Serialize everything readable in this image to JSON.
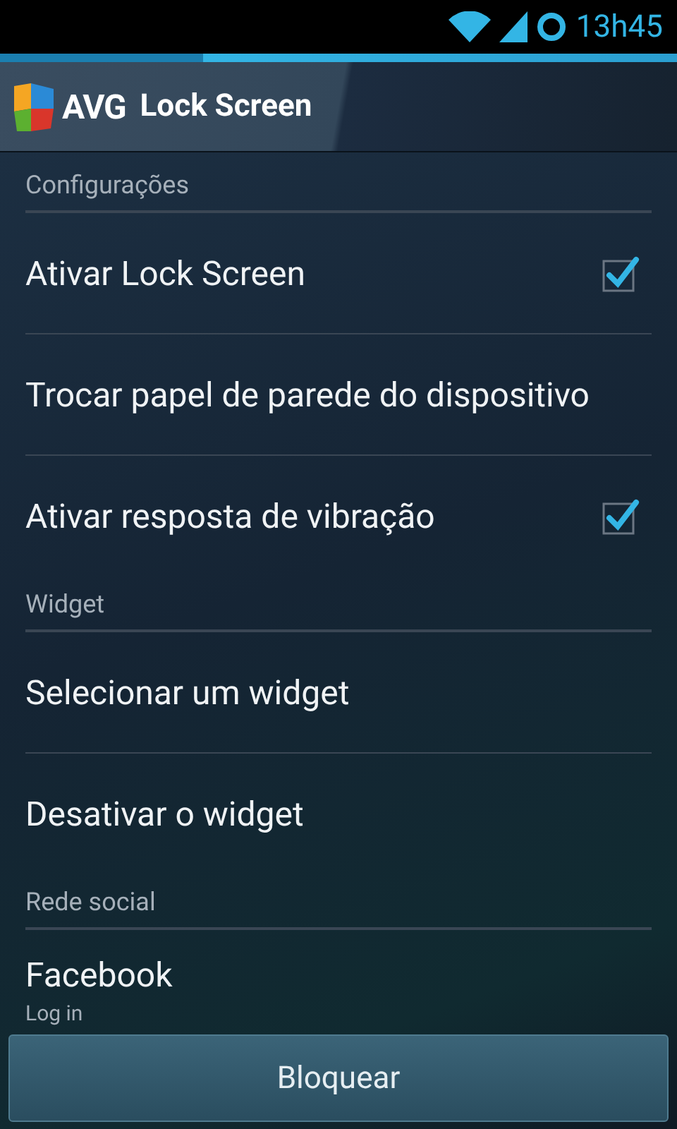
{
  "status_bar": {
    "time": "13h45"
  },
  "app_bar": {
    "brand": "AVG",
    "title": "Lock Screen"
  },
  "sections": [
    {
      "header": "Configurações",
      "items": [
        {
          "kind": "checkbox",
          "title": "Ativar Lock Screen",
          "checked": true
        },
        {
          "kind": "plain",
          "title": "Trocar papel de parede do dispositivo"
        },
        {
          "kind": "checkbox",
          "title": "Ativar resposta de vibração",
          "checked": true
        }
      ]
    },
    {
      "header": "Widget",
      "items": [
        {
          "kind": "plain",
          "title": "Selecionar um widget"
        },
        {
          "kind": "plain",
          "title": "Desativar o widget"
        }
      ]
    },
    {
      "header": "Rede social",
      "items": [
        {
          "kind": "plain",
          "title": "Facebook",
          "summary": "Log in"
        }
      ]
    }
  ],
  "button": {
    "label": "Bloquear"
  }
}
